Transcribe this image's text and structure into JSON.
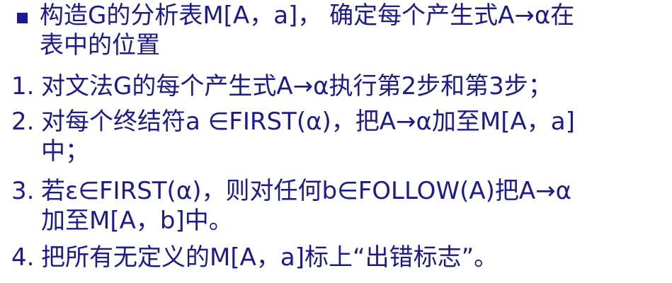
{
  "heading": {
    "line1": "构造G的分析表M[A，a]， 确定每个产生式A→α在",
    "line2": "表中的位置"
  },
  "steps": [
    {
      "number": "1.",
      "lines": [
        "对文法G的每个产生式A→α执行第2步和第3步；"
      ]
    },
    {
      "number": "2.",
      "lines": [
        "对每个终结符a ∈FIRST(α)，把A→α加至M[A，a]",
        "中；"
      ]
    },
    {
      "number": "3.",
      "lines": [
        "若ε∈FIRST(α)，则对任何b∈FOLLOW(A)把A→α",
        "加至M[A，b]中。"
      ]
    },
    {
      "number": "4.",
      "lines": [
        "把所有无定义的M[A，a]标上“出错标志”。"
      ]
    }
  ],
  "colors": {
    "text": "#1a1a99"
  }
}
